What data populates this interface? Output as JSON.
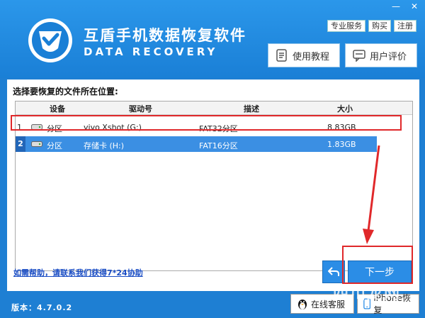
{
  "app": {
    "title": "互盾手机数据恢复软件",
    "subtitle": "DATA RECOVERY",
    "version": "版本：4.7.0.2"
  },
  "top_links": [
    "专业服务",
    "购买",
    "注册"
  ],
  "window_buttons": [
    "—",
    "✕"
  ],
  "header_buttons": {
    "tutorial": "使用教程",
    "review": "用户评价"
  },
  "main": {
    "section_title": "选择要恢复的文件所在位置:",
    "columns": [
      "设备",
      "驱动号",
      "描述",
      "大小"
    ],
    "rows": [
      {
        "num": "1",
        "device": "分区",
        "drive": "vivo Xshot (G:)",
        "desc": "FAT32分区",
        "size": "8.83GB"
      },
      {
        "num": "2",
        "device": "分区",
        "drive": "存储卡 (H:)",
        "desc": "FAT16分区",
        "size": "1.83GB"
      }
    ]
  },
  "help_link": "如需帮助，请联系我们获得7*24协助",
  "buttons": {
    "next": "下一步"
  },
  "footer": {
    "online_service": "在线客服",
    "iphone_recovery": "iPhone恢复"
  },
  "watermark": "四川龙网",
  "colors": {
    "header_bg": "#1e7fd3",
    "selected_row": "#3b8fe3",
    "highlight": "#e0282a"
  }
}
